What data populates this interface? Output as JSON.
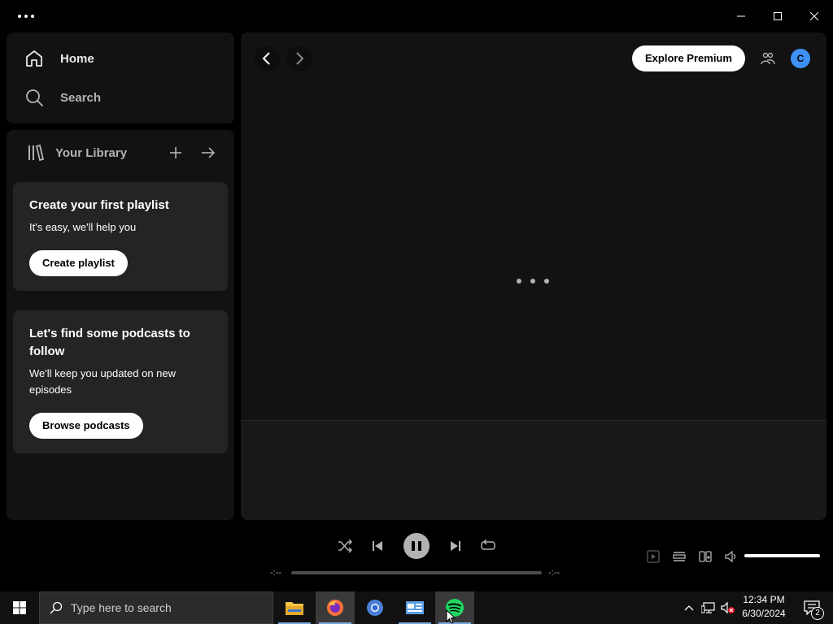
{
  "window": {
    "menu_icon": "more-dots-icon"
  },
  "nav": {
    "home_label": "Home",
    "search_label": "Search"
  },
  "library": {
    "title": "Your Library",
    "cards": [
      {
        "title": "Create your first playlist",
        "subtitle": "It's easy, we'll help you",
        "button": "Create playlist"
      },
      {
        "title": "Let's find some podcasts to follow",
        "subtitle": "We'll keep you updated on new episodes",
        "button": "Browse podcasts"
      }
    ]
  },
  "header": {
    "explore_label": "Explore Premium",
    "avatar_initial": "C",
    "avatar_color": "#3d91f4"
  },
  "player": {
    "elapsed": "-:--",
    "remaining": "-:--",
    "progress_fraction": 0,
    "volume_fraction": 1.0,
    "state": "pause-icon"
  },
  "taskbar": {
    "search_placeholder": "Type here to search",
    "time": "12:34 PM",
    "date": "6/30/2024",
    "notification_count": "2"
  },
  "colors": {
    "background": "#000000",
    "panel": "#121212",
    "card": "#242424",
    "spotify_green": "#1ed760"
  }
}
